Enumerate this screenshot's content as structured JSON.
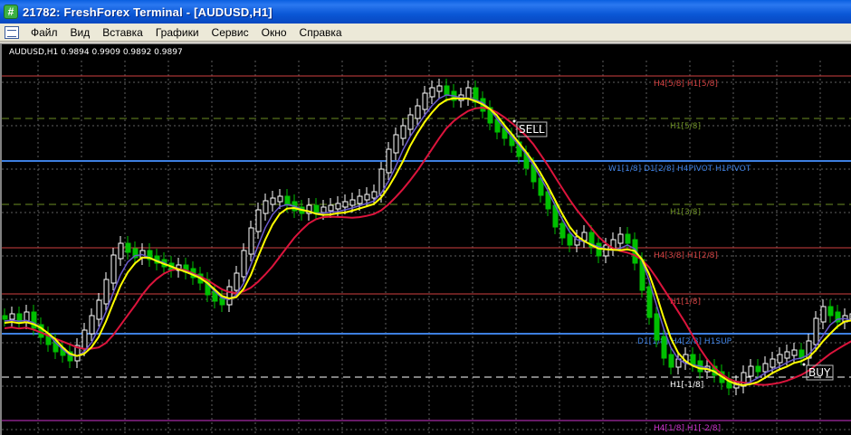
{
  "window": {
    "icon_glyph": "#",
    "title": "21782: FreshForex Terminal - [AUDUSD,H1]"
  },
  "menu": {
    "items": [
      "Файл",
      "Вид",
      "Вставка",
      "Графики",
      "Сервис",
      "Окно",
      "Справка"
    ]
  },
  "chart": {
    "symbol_info": "AUDUSD,H1  0.9894 0.9909 0.9892 0.9897",
    "colors": {
      "background": "#000000",
      "bull": "#ffffff",
      "bear": "#00c000",
      "ma_fast": "#ffff00",
      "ma_slow": "#dc143c",
      "ma_mid": "#6a5acd"
    },
    "levels": [
      {
        "label": "H4[5/8] H1[5/8]",
        "color": "#d04040",
        "style": "solid"
      },
      {
        "label": "H1[5/8]",
        "color": "#6b8e23",
        "style": "dashed"
      },
      {
        "label": "W1[1/8] D1[2/8] H4PIVOT H1PIVOT",
        "color": "#3d7fe0",
        "style": "thick"
      },
      {
        "label": "H1[3/8]",
        "color": "#6b8e23",
        "style": "dashed"
      },
      {
        "label": "H4[3/8] H1[2/8]",
        "color": "#d04040",
        "style": "solid"
      },
      {
        "label": "H1[1/8]",
        "color": "#d04040",
        "style": "solid"
      },
      {
        "label": "D1[1/8] H4[2/8] H1SUP",
        "color": "#3d7fe0",
        "style": "thick"
      },
      {
        "label": "H1[-1/8]",
        "color": "#ffffff",
        "style": "dashed"
      },
      {
        "label": "H4[1/8] H1[-2/8]",
        "color": "#cc33cc",
        "style": "solid"
      }
    ],
    "signals": [
      {
        "label": "SELL"
      },
      {
        "label": "BUY"
      }
    ]
  }
}
